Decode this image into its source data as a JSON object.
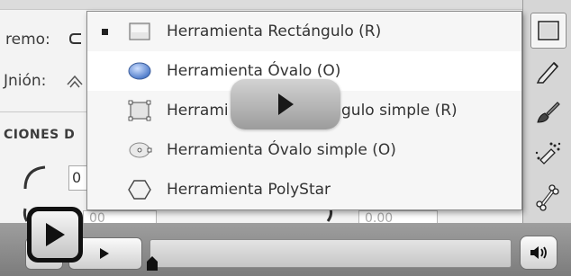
{
  "background_panel": {
    "label_extremo": "remo:",
    "label_union": "Jnión:",
    "section_title": "CIONES D",
    "field_left_value": "0",
    "field_small_left": "00",
    "field_small_right": "0.00"
  },
  "menu": {
    "items": [
      {
        "label": "Herramienta Rectángulo (R)",
        "icon": "rectangle-icon",
        "selected": true
      },
      {
        "label": "Herramienta Óvalo (O)",
        "icon": "oval-icon",
        "hovered": true
      },
      {
        "label_left": "Herrami",
        "label_right": "gulo simple (R)",
        "icon": "rectangle-primitive-icon"
      },
      {
        "label": "Herramienta Óvalo simple (O)",
        "icon": "oval-primitive-icon"
      },
      {
        "label": "Herramienta PolyStar",
        "icon": "polystar-icon"
      }
    ]
  },
  "toolbar": {
    "tools": [
      "rectangle-tool-icon",
      "pencil-icon",
      "brush-icon",
      "spray-brush-icon",
      "bone-icon"
    ]
  },
  "player": {
    "play_icon": "play-icon",
    "mute_icon": "speaker-icon"
  },
  "colors": {
    "panel_bg": "#f3f3f3",
    "menu_bg": "#f6f6f6",
    "hover_bg": "#ffffff",
    "bar_bg": "#8e8e8e",
    "oval_blue": "#5a86d6"
  }
}
